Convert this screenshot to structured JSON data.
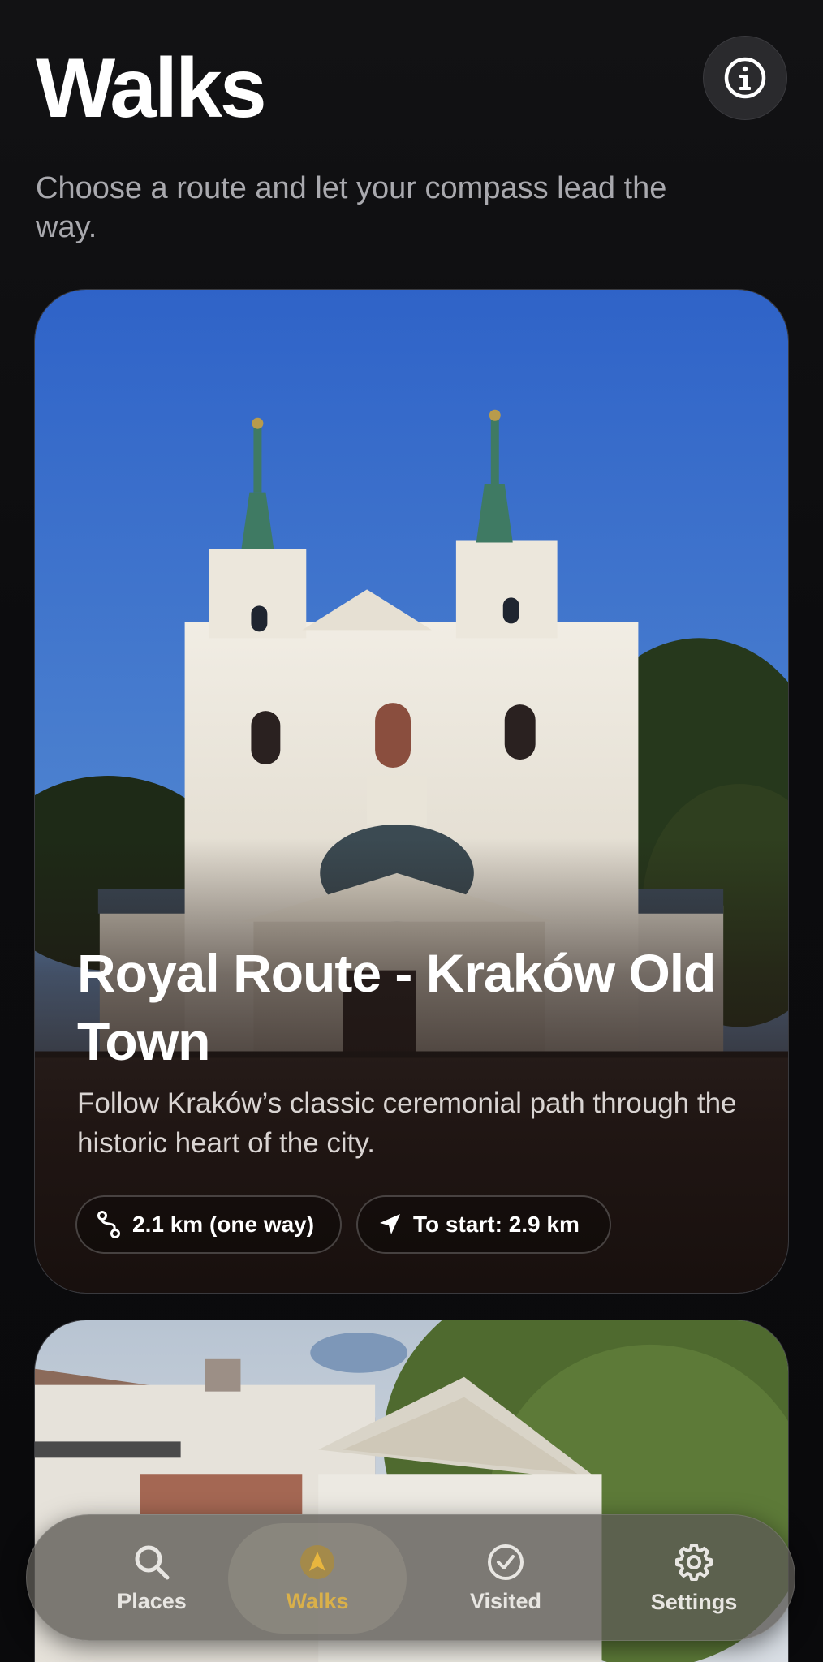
{
  "header": {
    "title": "Walks",
    "subtitle": "Choose a route and let your compass lead the way.",
    "info_icon": "info-circle-icon"
  },
  "walks": [
    {
      "title": "Royal Route - Kraków Old Town",
      "description": "Follow Kraków’s classic ceremonial path through the historic heart of the city.",
      "distance": "2.1 km (one way)",
      "distance_icon": "route-icon",
      "to_start": "To start: 2.9 km",
      "to_start_icon": "location-arrow-icon"
    },
    {
      "title": "",
      "description": ""
    }
  ],
  "tabbar": {
    "items": [
      {
        "label": "Places",
        "icon": "search-icon",
        "selected": false
      },
      {
        "label": "Walks",
        "icon": "compass-icon",
        "selected": true
      },
      {
        "label": "Visited",
        "icon": "check-circle-icon",
        "selected": false
      },
      {
        "label": "Settings",
        "icon": "gear-icon",
        "selected": false
      }
    ]
  },
  "colors": {
    "accent": "#d9b04a",
    "background": "#0b0b0d",
    "subtitle": "#a9a9ae"
  }
}
